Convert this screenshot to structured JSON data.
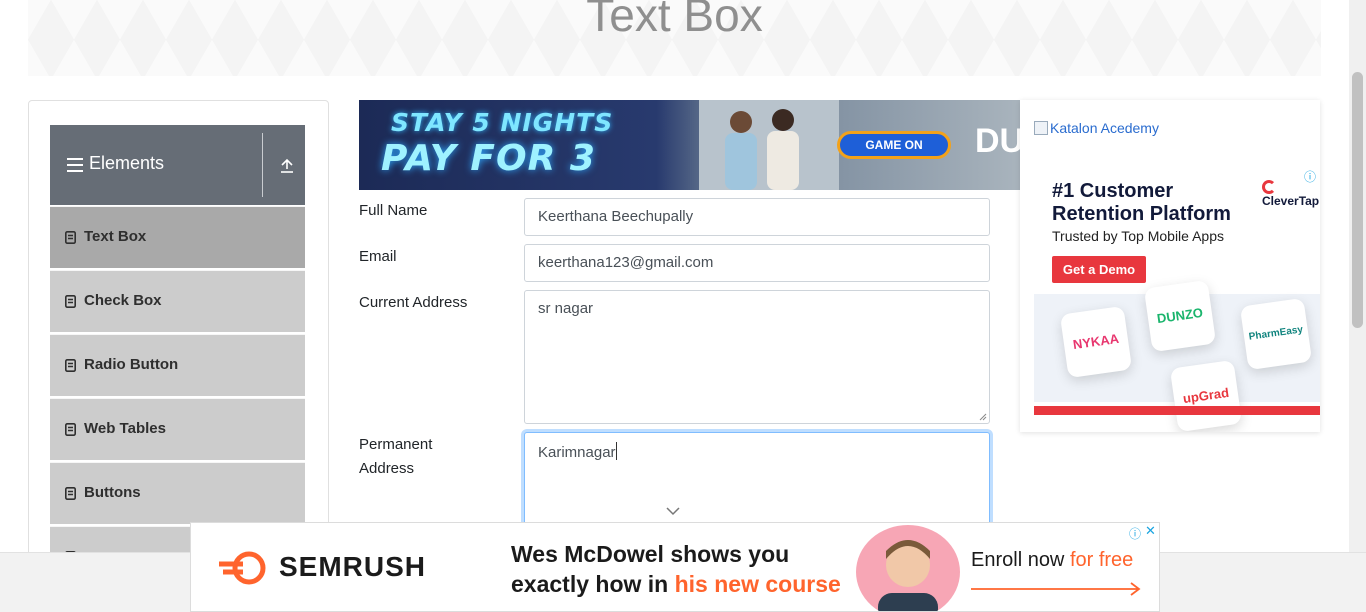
{
  "page": {
    "title": "Text Box"
  },
  "sidebar": {
    "group_title": "Elements",
    "items": [
      {
        "label": "Text Box",
        "active": true
      },
      {
        "label": "Check Box",
        "active": false
      },
      {
        "label": "Radio Button",
        "active": false
      },
      {
        "label": "Web Tables",
        "active": false
      },
      {
        "label": "Buttons",
        "active": false
      }
    ]
  },
  "form": {
    "full_name": {
      "label": "Full Name",
      "value": "Keerthana Beechupally"
    },
    "email": {
      "label": "Email",
      "value": "keerthana123@gmail.com"
    },
    "current_address": {
      "label": "Current Address",
      "value": "sr nagar"
    },
    "permanent_address": {
      "label_line1": "Permanent",
      "label_line2": "Address",
      "value": "Karimnagar"
    }
  },
  "ads": {
    "top_banner": {
      "line1": "STAY 5 NIGHTS",
      "line2": "PAY FOR 3",
      "button": "GAME ON",
      "brand_partial": "DU"
    },
    "right": {
      "image_alt": "Katalon Acedemy",
      "headline_line1": "#1 Customer",
      "headline_line2": "Retention Platform",
      "subtitle": "Trusted by Top Mobile Apps",
      "cta": "Get a Demo",
      "brand": "CleverTap",
      "tiles": [
        "NYKAA",
        "DUNZO",
        "PharmEasy",
        "upGrad"
      ]
    },
    "bottom": {
      "brand": "SEMRUSH",
      "headline_line1": "Wes McDowel shows you",
      "headline_line2_plain": "exactly how in ",
      "headline_line2_accent": "his new course",
      "enroll_plain": "Enroll now ",
      "enroll_accent": "for free"
    }
  },
  "colors": {
    "sidebar_header": "#666d76",
    "sidebar_item": "#cccccc",
    "sidebar_item_active": "#a9a9a9",
    "semrush_accent": "#ff642d",
    "clevertap_red": "#e8373e",
    "focus_blue": "#80bdff"
  }
}
